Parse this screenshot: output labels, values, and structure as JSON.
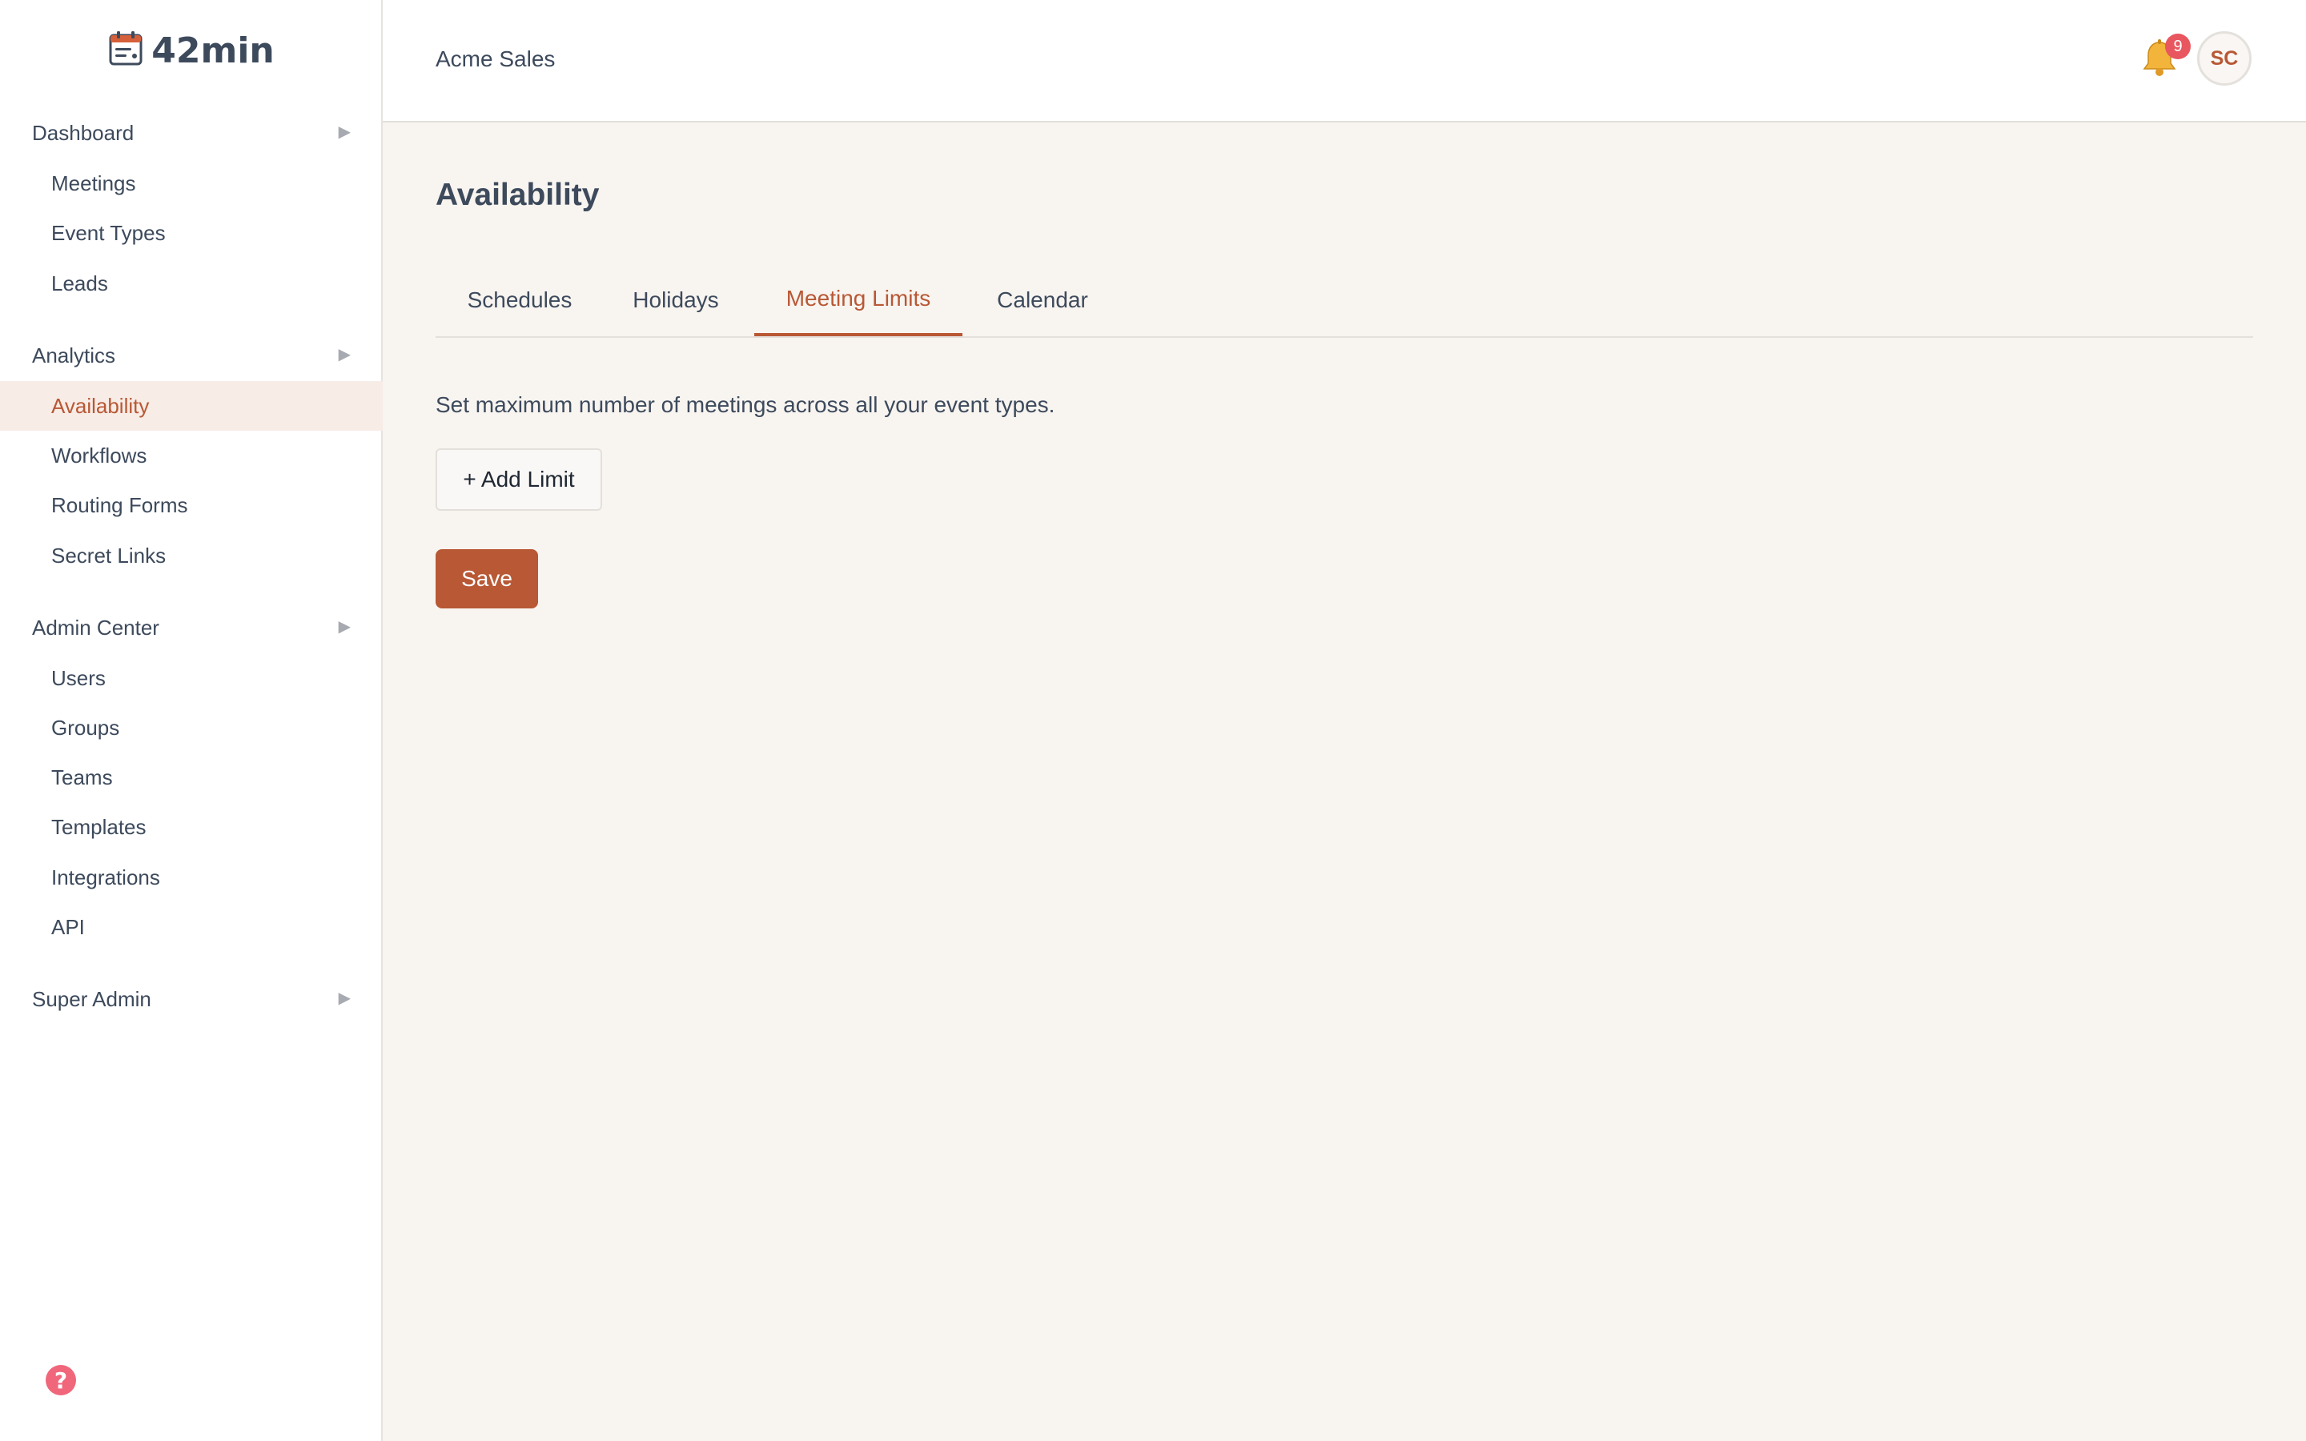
{
  "app": {
    "logo_text": "42min",
    "logo_icon": "calendar-icon",
    "accent_color": "#b85835"
  },
  "sidebar": {
    "sections": [
      {
        "label": "Dashboard",
        "items": [
          "Meetings",
          "Event Types",
          "Leads"
        ]
      },
      {
        "label": "Analytics",
        "items": [
          "Availability",
          "Workflows",
          "Routing Forms",
          "Secret Links"
        ]
      },
      {
        "label": "Admin Center",
        "items": [
          "Users",
          "Groups",
          "Teams",
          "Templates",
          "Integrations",
          "API"
        ]
      },
      {
        "label": "Super Admin",
        "items": []
      }
    ],
    "active_item": "Availability",
    "help_icon": "help-icon"
  },
  "header": {
    "org_name": "Acme Sales",
    "notification_count": "9",
    "avatar_initials": "SC"
  },
  "main": {
    "title": "Availability",
    "tabs": [
      "Schedules",
      "Holidays",
      "Meeting Limits",
      "Calendar"
    ],
    "active_tab": "Meeting Limits",
    "description": "Set maximum number of meetings across all your event types.",
    "add_limit_label": "+ Add Limit",
    "save_label": "Save"
  }
}
